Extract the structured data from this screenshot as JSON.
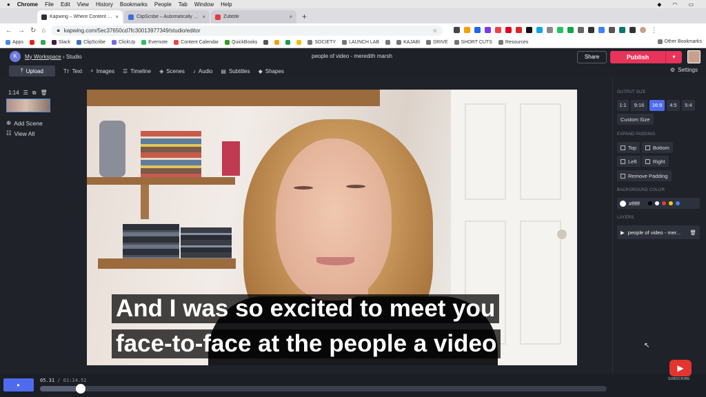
{
  "mac_menu": {
    "items": [
      "Chrome",
      "File",
      "Edit",
      "View",
      "History",
      "Bookmarks",
      "People",
      "Tab",
      "Window",
      "Help"
    ]
  },
  "browser": {
    "tabs": [
      {
        "title": "Kapwing – Where Content Crea",
        "fav": "#2b2f38",
        "active": true
      },
      {
        "title": "ClipScribe – Automatically crea",
        "fav": "#3b6fd1",
        "active": false
      },
      {
        "title": "Zubtitle",
        "fav": "#e23b3b",
        "active": false
      }
    ],
    "new_tab": "+",
    "url": "kapwing.com/5ec37650cd7fc30013977349/studio/editor"
  },
  "bookmarks": {
    "items": [
      {
        "label": "Apps",
        "color": "#4285f4"
      },
      {
        "label": "",
        "color": "#e62117"
      },
      {
        "label": "",
        "color": "#34a853"
      },
      {
        "label": "Slack",
        "color": "#4a154b"
      },
      {
        "label": "ClipScribe",
        "color": "#3b6fd1"
      },
      {
        "label": "ClickUp",
        "color": "#7b68ee"
      },
      {
        "label": "Evernote",
        "color": "#2dbe60"
      },
      {
        "label": "Content Calendar",
        "color": "#ef4444"
      },
      {
        "label": "QuickBooks",
        "color": "#2ca01c"
      },
      {
        "label": "",
        "color": "#555"
      },
      {
        "label": "",
        "color": "#f59e0b"
      },
      {
        "label": "",
        "color": "#0f9d58"
      },
      {
        "label": "",
        "color": "#fbbc04"
      },
      {
        "label": "SOCIETY",
        "color": "#777"
      },
      {
        "label": "LAUNCH LAB",
        "color": "#777"
      },
      {
        "label": "",
        "color": "#777"
      },
      {
        "label": "KAJABI",
        "color": "#777"
      },
      {
        "label": "DRIVE",
        "color": "#777"
      },
      {
        "label": "SHORT CUTS",
        "color": "#777"
      },
      {
        "label": "Resources",
        "color": "#777"
      }
    ],
    "other": "Other Bookmarks"
  },
  "app": {
    "workspace": "My Workspace",
    "section": "Studio",
    "separator": "›",
    "project_title": "people of video - meredith marsh",
    "share": "Share",
    "publish": "Publish",
    "publish_drop": "▾",
    "toolbar": [
      {
        "label": "Upload",
        "icon": "upload-icon",
        "glyph": "⤒"
      },
      {
        "label": "Text",
        "icon": "text-icon",
        "glyph": "Tт"
      },
      {
        "label": "Images",
        "icon": "search-icon",
        "glyph": "⌕"
      },
      {
        "label": "Timeline",
        "icon": "timeline-icon",
        "glyph": "☰"
      },
      {
        "label": "Scenes",
        "icon": "layers-icon",
        "glyph": "◈"
      },
      {
        "label": "Audio",
        "icon": "music-icon",
        "glyph": "♪"
      },
      {
        "label": "Subtitles",
        "icon": "subtitles-icon",
        "glyph": "▤"
      },
      {
        "label": "Shapes",
        "icon": "shapes-icon",
        "glyph": "◆"
      }
    ],
    "settings": "Settings"
  },
  "scenes": {
    "duration": "1:14",
    "add_scene": "Add Scene",
    "view_all": "View All"
  },
  "captions": {
    "line1": "And I was so excited to meet you",
    "line2": "face-to-face at the people a video"
  },
  "panel": {
    "output_size_label": "OUTPUT SIZE",
    "sizes": [
      "1:1",
      "9:16",
      "16:9",
      "4:5",
      "5:4"
    ],
    "active_size": "16:9",
    "custom_size": "Custom Size",
    "expand_padding_label": "EXPAND PADDING",
    "padding": [
      "Top",
      "Bottom",
      "Left",
      "Right"
    ],
    "remove_padding": "Remove Padding",
    "background_color_label": "BACKGROUND COLOR",
    "background_color": "#ffffff",
    "swatches": [
      "#000000",
      "#ffffff",
      "#e23b3b",
      "#f5c518",
      "#3b82f6"
    ],
    "layers_label": "LAYERS",
    "layer_name": "people of video - mer..."
  },
  "playback": {
    "current": "05.31",
    "divider": "/",
    "total": "01:14.52",
    "progress": 0.0713,
    "play": "▸"
  },
  "youtube": {
    "subscribe": "SUBSCRIBE"
  }
}
